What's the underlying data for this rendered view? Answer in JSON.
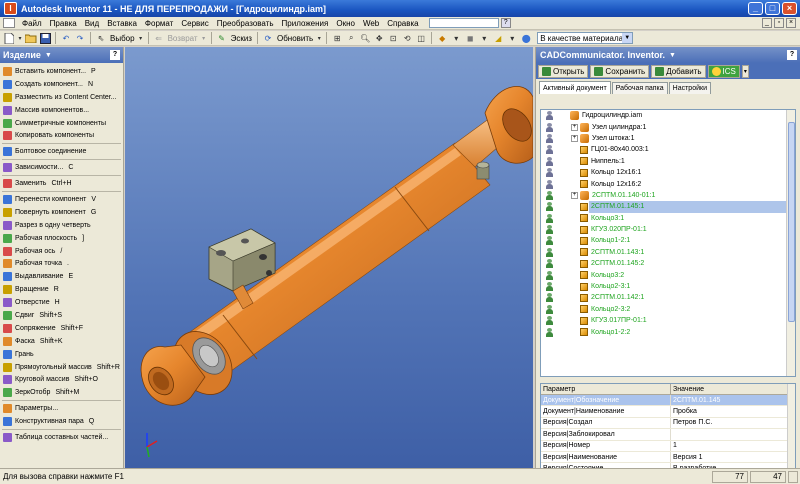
{
  "window": {
    "title": "Autodesk Inventor 11 - НЕ ДЛЯ ПЕРЕПРОДАЖИ - [Гидроцилиндр.iam]"
  },
  "menu": [
    "Файл",
    "Правка",
    "Вид",
    "Вставка",
    "Формат",
    "Сервис",
    "Преобразовать",
    "Приложения",
    "Окно",
    "Web",
    "Справка"
  ],
  "toolbar": {
    "select_label": "Выбор",
    "return_label": "Возврат",
    "sketch_label": "Эскиз",
    "update_label": "Обновить",
    "material_value": "В качестве материала"
  },
  "left_panel": {
    "title": "Изделие",
    "items": [
      {
        "label": "Вставить компонент...",
        "key": "P"
      },
      {
        "label": "Создать компонент...",
        "key": "N"
      },
      {
        "label": "Разместить из Content Center...",
        "key": ""
      },
      {
        "label": "Массив компонентов...",
        "key": ""
      },
      {
        "label": "Симметричные компоненты",
        "key": ""
      },
      {
        "label": "Копировать компоненты",
        "key": ""
      },
      {
        "sep": true
      },
      {
        "label": "Болтовое соединение",
        "key": ""
      },
      {
        "sep": true
      },
      {
        "label": "Зависимости...",
        "key": "C"
      },
      {
        "sep": true
      },
      {
        "label": "Заменить",
        "key": "Ctrl+H"
      },
      {
        "sep": true
      },
      {
        "label": "Перенести компонент",
        "key": "V"
      },
      {
        "label": "Повернуть компонент",
        "key": "G"
      },
      {
        "label": "Разрез в одну четверть",
        "key": ""
      },
      {
        "label": "Рабочая плоскость",
        "key": "]"
      },
      {
        "label": "Рабочая ось",
        "key": "/"
      },
      {
        "label": "Рабочая точка",
        "key": "."
      },
      {
        "label": "Выдавливание",
        "key": "E"
      },
      {
        "label": "Вращение",
        "key": "R"
      },
      {
        "label": "Отверстие",
        "key": "H"
      },
      {
        "label": "Сдвиг",
        "key": "Shift+S"
      },
      {
        "label": "Сопряжение",
        "key": "Shift+F"
      },
      {
        "label": "Фаска",
        "key": "Shift+K"
      },
      {
        "label": "Грань",
        "key": ""
      },
      {
        "label": "Прямоугольный массив",
        "key": "Shift+R"
      },
      {
        "label": "Круговой массив",
        "key": "Shift+O"
      },
      {
        "label": "ЗеркОтобр",
        "key": "Shift+M"
      },
      {
        "sep": true
      },
      {
        "label": "Параметры...",
        "key": ""
      },
      {
        "label": "Конструктивная пара",
        "key": "Q"
      },
      {
        "sep": true
      },
      {
        "label": "Таблица составных частей...",
        "key": ""
      }
    ]
  },
  "right_panel": {
    "title": "CADCommunicator. Inventor.",
    "buttons": {
      "open": "Открыть",
      "save": "Сохранить",
      "add": "Добавить",
      "ics": "ICS"
    },
    "tabs": [
      "Активный документ",
      "Рабочая папка",
      "Настройки"
    ],
    "tree": [
      {
        "label": "Гидроцилиндр.iam",
        "indent": 0,
        "type": "asm",
        "green": false,
        "user": "grey",
        "exp": false
      },
      {
        "label": "Узел цилиндра:1",
        "indent": 1,
        "type": "asm",
        "green": false,
        "user": "grey",
        "exp": true
      },
      {
        "label": "Узел штока:1",
        "indent": 1,
        "type": "asm",
        "green": false,
        "user": "grey",
        "exp": true
      },
      {
        "label": "ГЦ01-80х40.003:1",
        "indent": 1,
        "type": "part",
        "green": false,
        "user": "grey",
        "exp": false
      },
      {
        "label": "Ниппель:1",
        "indent": 1,
        "type": "part",
        "green": false,
        "user": "grey",
        "exp": false
      },
      {
        "label": "Кольцо 12х16:1",
        "indent": 1,
        "type": "part",
        "green": false,
        "user": "grey",
        "exp": false
      },
      {
        "label": "Кольцо 12х16:2",
        "indent": 1,
        "type": "part",
        "green": false,
        "user": "grey",
        "exp": false
      },
      {
        "label": "2СПТМ.01.140-01:1",
        "indent": 1,
        "type": "asm",
        "green": true,
        "user": "green",
        "exp": true
      },
      {
        "label": "2СПТМ.01.145:1",
        "indent": 1,
        "type": "part",
        "green": true,
        "user": "green",
        "exp": false,
        "selected": true
      },
      {
        "label": "Кольцо3:1",
        "indent": 1,
        "type": "part",
        "green": true,
        "user": "green",
        "exp": false
      },
      {
        "label": "КГУЗ.020ПР-01:1",
        "indent": 1,
        "type": "part",
        "green": true,
        "user": "green",
        "exp": false
      },
      {
        "label": "Кольцо1-2:1",
        "indent": 1,
        "type": "part",
        "green": true,
        "user": "green",
        "exp": false
      },
      {
        "label": "2СПТМ.01.143:1",
        "indent": 1,
        "type": "part",
        "green": true,
        "user": "green",
        "exp": false
      },
      {
        "label": "2СПТМ.01.145:2",
        "indent": 1,
        "type": "part",
        "green": true,
        "user": "green",
        "exp": false
      },
      {
        "label": "Кольцо3:2",
        "indent": 1,
        "type": "part",
        "green": true,
        "user": "green",
        "exp": false
      },
      {
        "label": "Кольцо2-3:1",
        "indent": 1,
        "type": "part",
        "green": true,
        "user": "green",
        "exp": false
      },
      {
        "label": "2СПТМ.01.142:1",
        "indent": 1,
        "type": "part",
        "green": true,
        "user": "green",
        "exp": false
      },
      {
        "label": "Кольцо2-3:2",
        "indent": 1,
        "type": "part",
        "green": true,
        "user": "green",
        "exp": false
      },
      {
        "label": "КГУЗ.017ПР-01:1",
        "indent": 1,
        "type": "part",
        "green": true,
        "user": "green",
        "exp": false
      },
      {
        "label": "Кольцо1-2:2",
        "indent": 1,
        "type": "part",
        "green": true,
        "user": "green",
        "exp": false
      }
    ],
    "props_header": [
      "Параметр",
      "Значение"
    ],
    "props": [
      {
        "name": "Документ|Обозначение",
        "value": "2СПТМ.01.145",
        "selected": true
      },
      {
        "name": "Документ|Наименование",
        "value": "Пробка"
      },
      {
        "name": "Версия|Создал",
        "value": "Петров П.С."
      },
      {
        "name": "Версия|Заблокировал",
        "value": ""
      },
      {
        "name": "Версия|Номер",
        "value": "1"
      },
      {
        "name": "Версия|Наименование",
        "value": "Версия 1"
      },
      {
        "name": "Версия|Состояние",
        "value": "В разработке"
      },
      {
        "name": "Версия|Активная",
        "value": "Т"
      },
      {
        "name": "Редактирование файлового состава",
        "value": "Т"
      }
    ]
  },
  "status": {
    "message": "Для вызова справки нажмите F1",
    "value1": "77",
    "value2": "47"
  }
}
